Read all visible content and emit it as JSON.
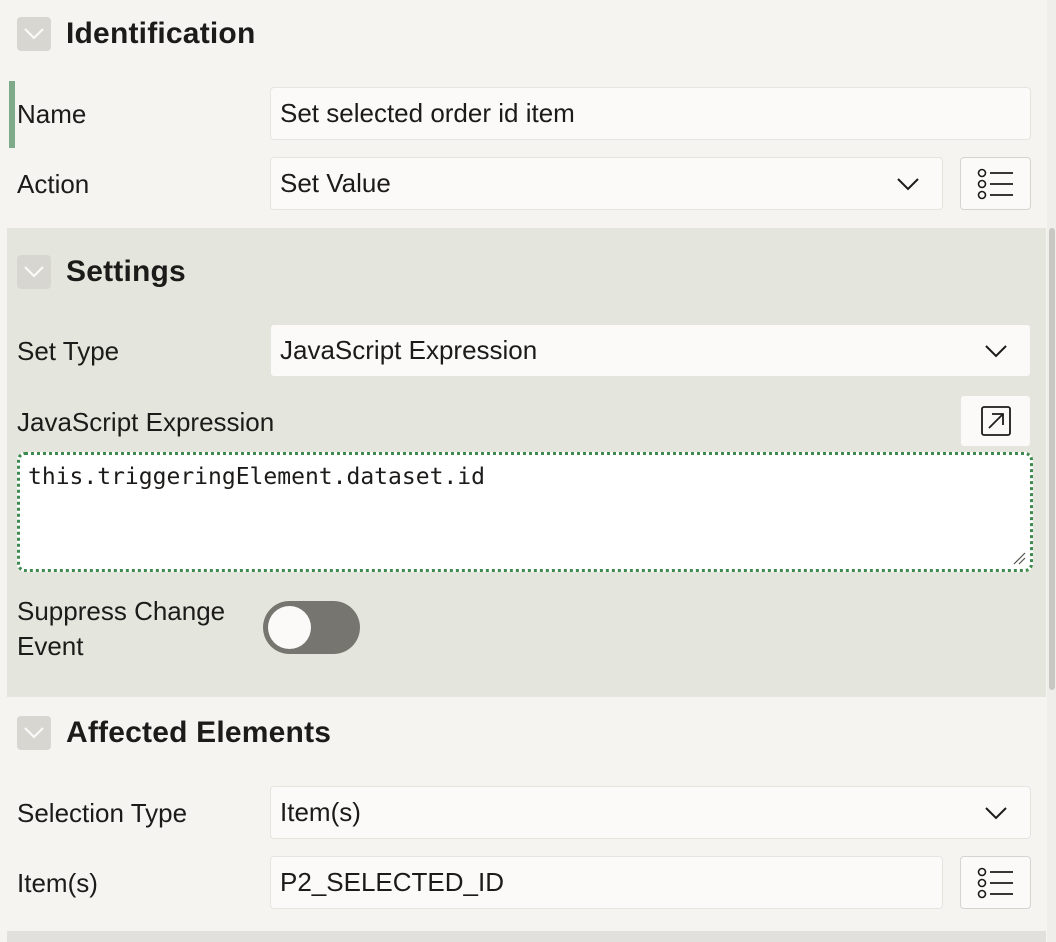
{
  "identification": {
    "title": "Identification",
    "name_label": "Name",
    "name_value": "Set selected order id item",
    "action_label": "Action",
    "action_value": "Set Value"
  },
  "settings": {
    "title": "Settings",
    "set_type_label": "Set Type",
    "set_type_value": "JavaScript Expression",
    "js_expression_label": "JavaScript Expression",
    "js_expression_value": "this.triggeringElement.dataset.id",
    "suppress_change_label": "Suppress Change Event",
    "suppress_change_on": false
  },
  "affected_elements": {
    "title": "Affected Elements",
    "selection_type_label": "Selection Type",
    "selection_type_value": "Item(s)",
    "items_label": "Item(s)",
    "items_value": "P2_SELECTED_ID"
  },
  "colors": {
    "active_section_bg": "#e4e6dd",
    "focus_outline": "#3f8a4e",
    "switch_off": "#77756f"
  },
  "icons": {
    "collapse": "chevron-down-icon",
    "list_of_values": "list-icon",
    "expand_editor": "expand-arrow-icon"
  }
}
